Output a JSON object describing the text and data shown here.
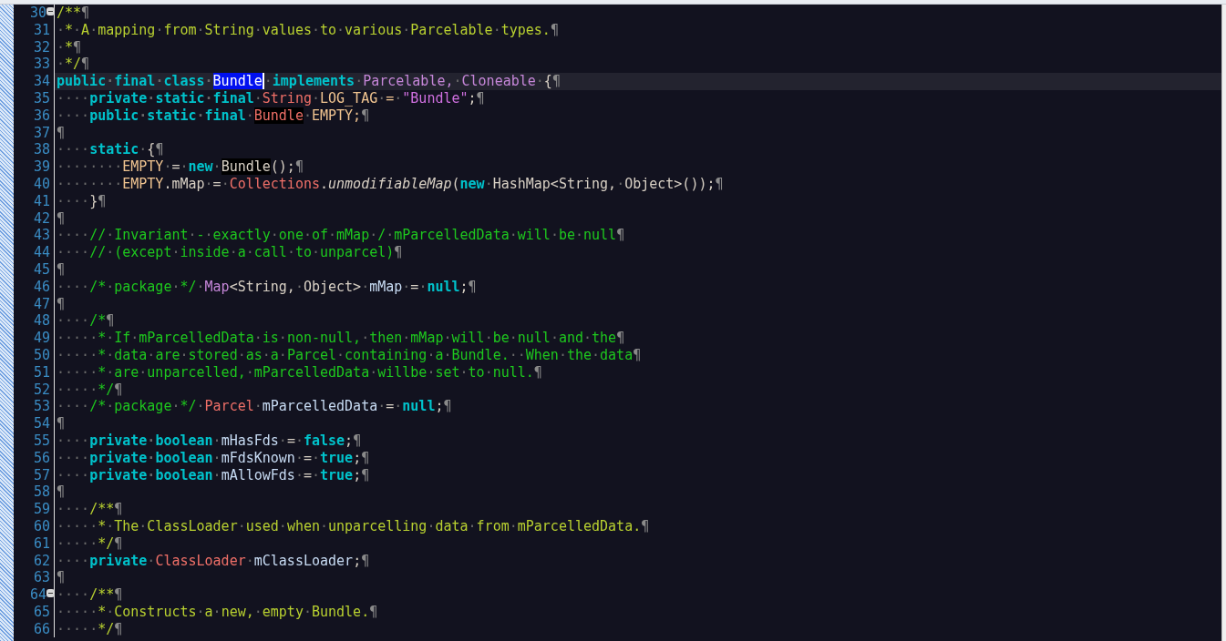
{
  "editor": {
    "lines": [
      {
        "number": "30",
        "fold": true,
        "current": false,
        "tokens": [
          {
            "kind": "doc",
            "text": "/**"
          },
          {
            "kind": "eol",
            "text": "¶"
          }
        ]
      },
      {
        "number": "31",
        "fold": false,
        "current": false,
        "tokens": [
          {
            "kind": "doc",
            "text": "·*·A·mapping·from·String·values·to·various·Parcelable·types."
          },
          {
            "kind": "eol",
            "text": "¶"
          }
        ]
      },
      {
        "number": "32",
        "fold": false,
        "current": false,
        "tokens": [
          {
            "kind": "doc",
            "text": "·*"
          },
          {
            "kind": "eol",
            "text": "¶"
          }
        ]
      },
      {
        "number": "33",
        "fold": false,
        "current": false,
        "tokens": [
          {
            "kind": "doc",
            "text": "·*/"
          },
          {
            "kind": "eol",
            "text": "¶"
          }
        ]
      },
      {
        "number": "34",
        "fold": false,
        "current": true,
        "tokens": [
          {
            "kind": "kw",
            "text": "public·final·class·"
          },
          {
            "kind": "sel",
            "text": "Bundle"
          },
          {
            "kind": "plain",
            "text": "·"
          },
          {
            "kind": "kw",
            "text": "implements"
          },
          {
            "kind": "plain",
            "text": "·"
          },
          {
            "kind": "iface",
            "text": "Parcelable,·Cloneable"
          },
          {
            "kind": "plain",
            "text": "·{"
          },
          {
            "kind": "eol",
            "text": "¶"
          }
        ]
      },
      {
        "number": "35",
        "fold": false,
        "current": false,
        "tokens": [
          {
            "kind": "plain",
            "text": "····"
          },
          {
            "kind": "kw",
            "text": "private·static·final"
          },
          {
            "kind": "plain",
            "text": "·"
          },
          {
            "kind": "type",
            "text": "String"
          },
          {
            "kind": "field",
            "text": "·LOG_TAG·=·"
          },
          {
            "kind": "str",
            "text": "\"Bundle\""
          },
          {
            "kind": "plain",
            "text": ";"
          },
          {
            "kind": "eol",
            "text": "¶"
          }
        ]
      },
      {
        "number": "36",
        "fold": false,
        "current": false,
        "tokens": [
          {
            "kind": "plain",
            "text": "····"
          },
          {
            "kind": "kw",
            "text": "public·static·final"
          },
          {
            "kind": "plain",
            "text": "·"
          },
          {
            "kind": "match",
            "text": "Bundle"
          },
          {
            "kind": "field",
            "text": "·EMPTY;"
          },
          {
            "kind": "eol",
            "text": "¶"
          }
        ]
      },
      {
        "number": "37",
        "fold": false,
        "current": false,
        "tokens": [
          {
            "kind": "eol",
            "text": "¶"
          }
        ]
      },
      {
        "number": "38",
        "fold": false,
        "current": false,
        "tokens": [
          {
            "kind": "plain",
            "text": "····"
          },
          {
            "kind": "kw",
            "text": "static"
          },
          {
            "kind": "plain",
            "text": "·{"
          },
          {
            "kind": "eol",
            "text": "¶"
          }
        ]
      },
      {
        "number": "39",
        "fold": false,
        "current": false,
        "tokens": [
          {
            "kind": "plain",
            "text": "········"
          },
          {
            "kind": "field",
            "text": "EMPTY"
          },
          {
            "kind": "plain",
            "text": "·=·"
          },
          {
            "kind": "kw",
            "text": "new"
          },
          {
            "kind": "plain",
            "text": "·"
          },
          {
            "kind": "matchplain",
            "text": "Bundle"
          },
          {
            "kind": "plain",
            "text": "();"
          },
          {
            "kind": "eol",
            "text": "¶"
          }
        ]
      },
      {
        "number": "40",
        "fold": false,
        "current": false,
        "tokens": [
          {
            "kind": "plain",
            "text": "········"
          },
          {
            "kind": "field",
            "text": "EMPTY"
          },
          {
            "kind": "plain",
            "text": ".mMap·=·"
          },
          {
            "kind": "type",
            "text": "Collections"
          },
          {
            "kind": "plain",
            "text": "."
          },
          {
            "kind": "method",
            "text": "unmodifiableMap"
          },
          {
            "kind": "plain",
            "text": "("
          },
          {
            "kind": "kw",
            "text": "new"
          },
          {
            "kind": "plain",
            "text": "·HashMap<String,·Object>());"
          },
          {
            "kind": "eol",
            "text": "¶"
          }
        ]
      },
      {
        "number": "41",
        "fold": false,
        "current": false,
        "tokens": [
          {
            "kind": "plain",
            "text": "····}"
          },
          {
            "kind": "eol",
            "text": "¶"
          }
        ]
      },
      {
        "number": "42",
        "fold": false,
        "current": false,
        "tokens": [
          {
            "kind": "eol",
            "text": "¶"
          }
        ]
      },
      {
        "number": "43",
        "fold": false,
        "current": false,
        "tokens": [
          {
            "kind": "plain",
            "text": "····"
          },
          {
            "kind": "comment",
            "text": "//·Invariant·-·exactly·one·of·mMap·/·mParcelledData·will·be·null"
          },
          {
            "kind": "eol",
            "text": "¶"
          }
        ]
      },
      {
        "number": "44",
        "fold": false,
        "current": false,
        "tokens": [
          {
            "kind": "plain",
            "text": "····"
          },
          {
            "kind": "comment",
            "text": "//·(except·inside·a·call·to·unparcel)"
          },
          {
            "kind": "eol",
            "text": "¶"
          }
        ]
      },
      {
        "number": "45",
        "fold": false,
        "current": false,
        "tokens": [
          {
            "kind": "eol",
            "text": "¶"
          }
        ]
      },
      {
        "number": "46",
        "fold": false,
        "current": false,
        "tokens": [
          {
            "kind": "plain",
            "text": "····"
          },
          {
            "kind": "comment",
            "text": "/*·package·*/"
          },
          {
            "kind": "plain",
            "text": "·"
          },
          {
            "kind": "iface",
            "text": "Map"
          },
          {
            "kind": "plain",
            "text": "<String,·Object>·"
          },
          {
            "kind": "ident",
            "text": "mMap"
          },
          {
            "kind": "plain",
            "text": "·=·"
          },
          {
            "kind": "kw",
            "text": "null"
          },
          {
            "kind": "plain",
            "text": ";"
          },
          {
            "kind": "eol",
            "text": "¶"
          }
        ]
      },
      {
        "number": "47",
        "fold": false,
        "current": false,
        "tokens": [
          {
            "kind": "eol",
            "text": "¶"
          }
        ]
      },
      {
        "number": "48",
        "fold": false,
        "current": false,
        "tokens": [
          {
            "kind": "plain",
            "text": "····"
          },
          {
            "kind": "comment",
            "text": "/*"
          },
          {
            "kind": "eol",
            "text": "¶"
          }
        ]
      },
      {
        "number": "49",
        "fold": false,
        "current": false,
        "tokens": [
          {
            "kind": "plain",
            "text": "·····"
          },
          {
            "kind": "comment",
            "text": "*·If·mParcelledData·is·non-null,·then·mMap·will·be·null·and·the"
          },
          {
            "kind": "eol",
            "text": "¶"
          }
        ]
      },
      {
        "number": "50",
        "fold": false,
        "current": false,
        "tokens": [
          {
            "kind": "plain",
            "text": "·····"
          },
          {
            "kind": "comment",
            "text": "*·data·are·stored·as·a·Parcel·containing·a·Bundle.··When·the·data"
          },
          {
            "kind": "eol",
            "text": "¶"
          }
        ]
      },
      {
        "number": "51",
        "fold": false,
        "current": false,
        "tokens": [
          {
            "kind": "plain",
            "text": "·····"
          },
          {
            "kind": "comment",
            "text": "*·are·unparcelled,·mParcelledData·willbe·set·to·null."
          },
          {
            "kind": "eol",
            "text": "¶"
          }
        ]
      },
      {
        "number": "52",
        "fold": false,
        "current": false,
        "tokens": [
          {
            "kind": "plain",
            "text": "·····"
          },
          {
            "kind": "comment",
            "text": "*/"
          },
          {
            "kind": "eol",
            "text": "¶"
          }
        ]
      },
      {
        "number": "53",
        "fold": false,
        "current": false,
        "tokens": [
          {
            "kind": "plain",
            "text": "····"
          },
          {
            "kind": "comment",
            "text": "/*·package·*/"
          },
          {
            "kind": "plain",
            "text": "·"
          },
          {
            "kind": "type",
            "text": "Parcel"
          },
          {
            "kind": "plain",
            "text": "·"
          },
          {
            "kind": "ident",
            "text": "mParcelledData"
          },
          {
            "kind": "plain",
            "text": "·=·"
          },
          {
            "kind": "kw",
            "text": "null"
          },
          {
            "kind": "plain",
            "text": ";"
          },
          {
            "kind": "eol",
            "text": "¶"
          }
        ]
      },
      {
        "number": "54",
        "fold": false,
        "current": false,
        "tokens": [
          {
            "kind": "eol",
            "text": "¶"
          }
        ]
      },
      {
        "number": "55",
        "fold": false,
        "current": false,
        "tokens": [
          {
            "kind": "plain",
            "text": "····"
          },
          {
            "kind": "kw",
            "text": "private·boolean"
          },
          {
            "kind": "plain",
            "text": "·"
          },
          {
            "kind": "ident",
            "text": "mHasFds"
          },
          {
            "kind": "plain",
            "text": "·=·"
          },
          {
            "kind": "kw",
            "text": "false"
          },
          {
            "kind": "plain",
            "text": ";"
          },
          {
            "kind": "eol",
            "text": "¶"
          }
        ]
      },
      {
        "number": "56",
        "fold": false,
        "current": false,
        "tokens": [
          {
            "kind": "plain",
            "text": "····"
          },
          {
            "kind": "kw",
            "text": "private·boolean"
          },
          {
            "kind": "plain",
            "text": "·"
          },
          {
            "kind": "ident",
            "text": "mFdsKnown"
          },
          {
            "kind": "plain",
            "text": "·=·"
          },
          {
            "kind": "kw",
            "text": "true"
          },
          {
            "kind": "plain",
            "text": ";"
          },
          {
            "kind": "eol",
            "text": "¶"
          }
        ]
      },
      {
        "number": "57",
        "fold": false,
        "current": false,
        "tokens": [
          {
            "kind": "plain",
            "text": "····"
          },
          {
            "kind": "kw",
            "text": "private·boolean"
          },
          {
            "kind": "plain",
            "text": "·"
          },
          {
            "kind": "ident",
            "text": "mAllowFds"
          },
          {
            "kind": "plain",
            "text": "·=·"
          },
          {
            "kind": "kw",
            "text": "true"
          },
          {
            "kind": "plain",
            "text": ";"
          },
          {
            "kind": "eol",
            "text": "¶"
          }
        ]
      },
      {
        "number": "58",
        "fold": false,
        "current": false,
        "tokens": [
          {
            "kind": "eol",
            "text": "¶"
          }
        ]
      },
      {
        "number": "59",
        "fold": false,
        "current": false,
        "tokens": [
          {
            "kind": "plain",
            "text": "····"
          },
          {
            "kind": "doc",
            "text": "/**"
          },
          {
            "kind": "eol",
            "text": "¶"
          }
        ]
      },
      {
        "number": "60",
        "fold": false,
        "current": false,
        "tokens": [
          {
            "kind": "plain",
            "text": "·····"
          },
          {
            "kind": "doc",
            "text": "*·The·ClassLoader·used·when·unparcelling·data·from·mParcelledData."
          },
          {
            "kind": "eol",
            "text": "¶"
          }
        ]
      },
      {
        "number": "61",
        "fold": false,
        "current": false,
        "tokens": [
          {
            "kind": "plain",
            "text": "·····"
          },
          {
            "kind": "doc",
            "text": "*/"
          },
          {
            "kind": "eol",
            "text": "¶"
          }
        ]
      },
      {
        "number": "62",
        "fold": false,
        "current": false,
        "tokens": [
          {
            "kind": "plain",
            "text": "····"
          },
          {
            "kind": "kw",
            "text": "private"
          },
          {
            "kind": "plain",
            "text": "·"
          },
          {
            "kind": "type",
            "text": "ClassLoader"
          },
          {
            "kind": "plain",
            "text": "·"
          },
          {
            "kind": "ident",
            "text": "mClassLoader"
          },
          {
            "kind": "plain",
            "text": ";"
          },
          {
            "kind": "eol",
            "text": "¶"
          }
        ]
      },
      {
        "number": "63",
        "fold": false,
        "current": false,
        "tokens": [
          {
            "kind": "eol",
            "text": "¶"
          }
        ]
      },
      {
        "number": "64",
        "fold": true,
        "current": false,
        "tokens": [
          {
            "kind": "plain",
            "text": "····"
          },
          {
            "kind": "doc",
            "text": "/**"
          },
          {
            "kind": "eol",
            "text": "¶"
          }
        ]
      },
      {
        "number": "65",
        "fold": false,
        "current": false,
        "tokens": [
          {
            "kind": "plain",
            "text": "·····"
          },
          {
            "kind": "doc",
            "text": "*·Constructs·a·new,·empty·Bundle."
          },
          {
            "kind": "eol",
            "text": "¶"
          }
        ]
      },
      {
        "number": "66",
        "fold": false,
        "current": false,
        "tokens": [
          {
            "kind": "plain",
            "text": "·····"
          },
          {
            "kind": "doc",
            "text": "*/"
          },
          {
            "kind": "eol",
            "text": "¶"
          }
        ]
      }
    ]
  }
}
